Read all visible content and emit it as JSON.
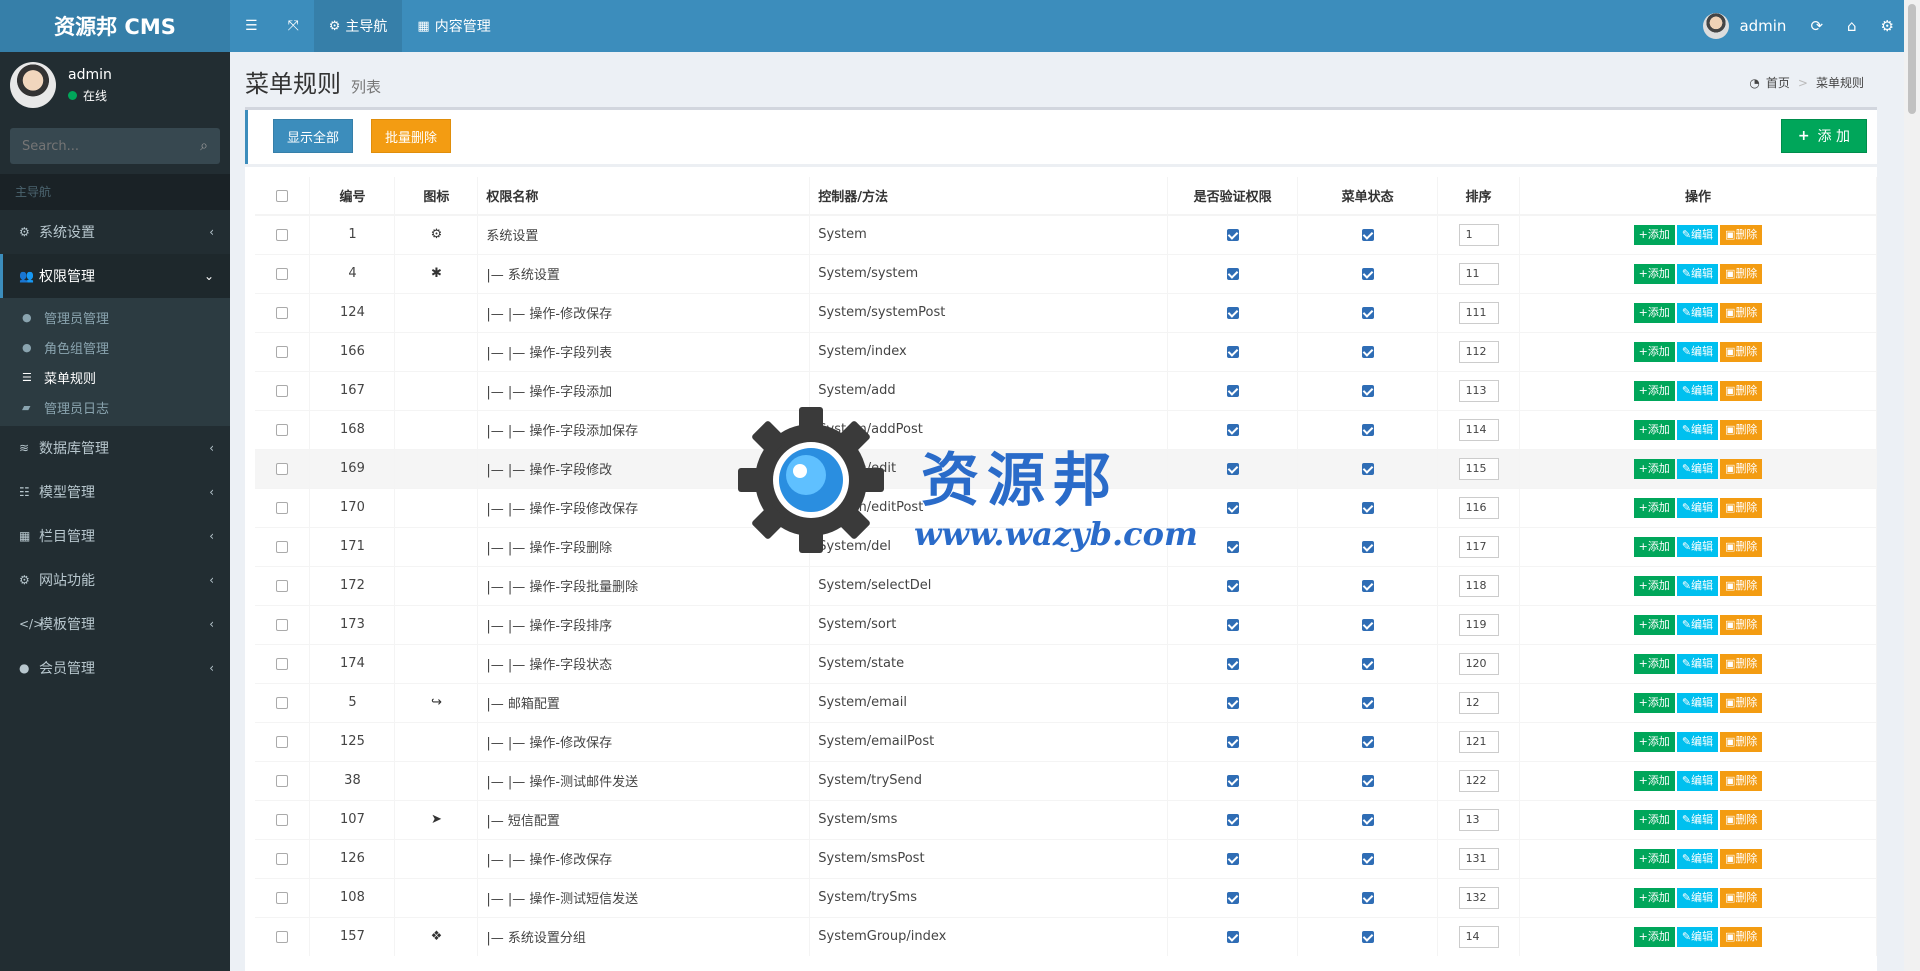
{
  "app": {
    "logo": "资源邦 CMS"
  },
  "topnav": {
    "toggle_icon": "bars-icon",
    "fullscreen_icon": "expand-icon",
    "main_nav": "主导航",
    "content_mgmt": "内容管理"
  },
  "topright": {
    "user": "admin"
  },
  "user_panel": {
    "name": "admin",
    "status": "在线"
  },
  "search": {
    "placeholder": "Search..."
  },
  "sidebar": {
    "header": "主导航",
    "items": [
      {
        "label": "系统设置",
        "icon": "cogs-icon"
      },
      {
        "label": "权限管理",
        "icon": "users-icon",
        "open": true
      },
      {
        "label": "数据库管理",
        "icon": "database-icon"
      },
      {
        "label": "模型管理",
        "icon": "list-icon"
      },
      {
        "label": "栏目管理",
        "icon": "th-icon"
      },
      {
        "label": "网站功能",
        "icon": "gear-icon"
      },
      {
        "label": "模板管理",
        "icon": "code-icon"
      },
      {
        "label": "会员管理",
        "icon": "user-icon"
      }
    ],
    "subitems": [
      {
        "label": "管理员管理",
        "icon": "user-icon"
      },
      {
        "label": "角色组管理",
        "icon": "users-icon"
      },
      {
        "label": "菜单规则",
        "icon": "list-icon",
        "active": true
      },
      {
        "label": "管理员日志",
        "icon": "book-icon"
      }
    ]
  },
  "page": {
    "title": "菜单规则",
    "subtitle": "列表"
  },
  "breadcrumb": {
    "home": "首页",
    "current": "菜单规则"
  },
  "toolbar": {
    "show_all": "显示全部",
    "batch_delete": "批量删除",
    "add": "添 加"
  },
  "table": {
    "headers": [
      "编号",
      "图标",
      "权限名称",
      "控制器/方法",
      "是否验证权限",
      "菜单状态",
      "排序",
      "操作"
    ],
    "op_labels": {
      "add": "添加",
      "edit": "编辑",
      "del": "删除"
    },
    "rows": [
      {
        "id": "1",
        "icon": "cogs-icon",
        "name": "系统设置",
        "ctrl": "System",
        "sort": "1"
      },
      {
        "id": "4",
        "icon": "gear-icon",
        "name": "|— 系统设置",
        "ctrl": "System/system",
        "sort": "11"
      },
      {
        "id": "124",
        "icon": "",
        "name": "|— |— 操作-修改保存",
        "ctrl": "System/systemPost",
        "sort": "111"
      },
      {
        "id": "166",
        "icon": "",
        "name": "|— |— 操作-字段列表",
        "ctrl": "System/index",
        "sort": "112"
      },
      {
        "id": "167",
        "icon": "",
        "name": "|— |— 操作-字段添加",
        "ctrl": "System/add",
        "sort": "113"
      },
      {
        "id": "168",
        "icon": "",
        "name": "|— |— 操作-字段添加保存",
        "ctrl": "System/addPost",
        "sort": "114"
      },
      {
        "id": "169",
        "icon": "",
        "name": "|— |— 操作-字段修改",
        "ctrl": "System/edit",
        "sort": "115"
      },
      {
        "id": "170",
        "icon": "",
        "name": "|— |— 操作-字段修改保存",
        "ctrl": "System/editPost",
        "sort": "116"
      },
      {
        "id": "171",
        "icon": "",
        "name": "|— |— 操作-字段删除",
        "ctrl": "System/del",
        "sort": "117"
      },
      {
        "id": "172",
        "icon": "",
        "name": "|— |— 操作-字段批量删除",
        "ctrl": "System/selectDel",
        "sort": "118"
      },
      {
        "id": "173",
        "icon": "",
        "name": "|— |— 操作-字段排序",
        "ctrl": "System/sort",
        "sort": "119"
      },
      {
        "id": "174",
        "icon": "",
        "name": "|— |— 操作-字段状态",
        "ctrl": "System/state",
        "sort": "120"
      },
      {
        "id": "5",
        "icon": "share-icon",
        "name": "|— 邮箱配置",
        "ctrl": "System/email",
        "sort": "12"
      },
      {
        "id": "125",
        "icon": "",
        "name": "|— |— 操作-修改保存",
        "ctrl": "System/emailPost",
        "sort": "121"
      },
      {
        "id": "38",
        "icon": "",
        "name": "|— |— 操作-测试邮件发送",
        "ctrl": "System/trySend",
        "sort": "122"
      },
      {
        "id": "107",
        "icon": "paper-plane-icon",
        "name": "|— 短信配置",
        "ctrl": "System/sms",
        "sort": "13"
      },
      {
        "id": "126",
        "icon": "",
        "name": "|— |— 操作-修改保存",
        "ctrl": "System/smsPost",
        "sort": "131"
      },
      {
        "id": "108",
        "icon": "",
        "name": "|— |— 操作-测试短信发送",
        "ctrl": "System/trySms",
        "sort": "132"
      },
      {
        "id": "157",
        "icon": "cubes-icon",
        "name": "|— 系统设置分组",
        "ctrl": "SystemGroup/index",
        "sort": "14"
      }
    ]
  },
  "watermark": {
    "title": "资源邦",
    "url": "www.wazyb.com"
  },
  "colors": {
    "header": "#3c8dbc",
    "sidebar": "#222d32",
    "success": "#00a65a",
    "info": "#00c0ef",
    "warning": "#f39c12"
  }
}
